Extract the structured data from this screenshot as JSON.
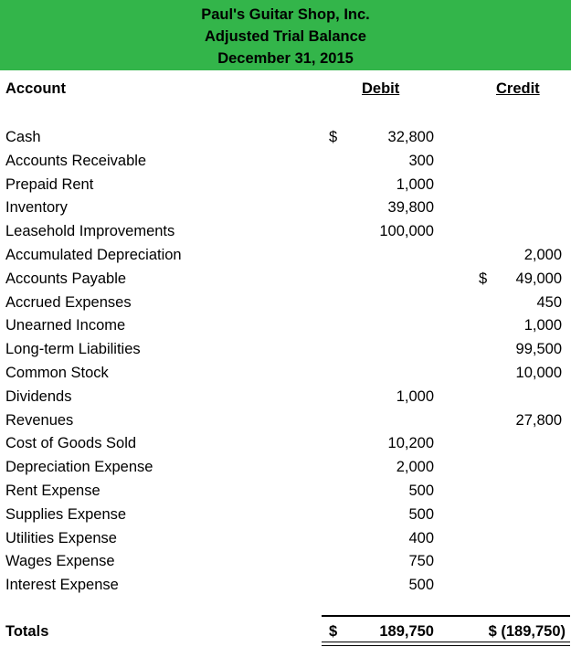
{
  "header": {
    "company": "Paul's Guitar Shop, Inc.",
    "title": "Adjusted Trial Balance",
    "date": "December 31, 2015",
    "banner_color": "#33b54a"
  },
  "columns": {
    "account": "Account",
    "debit": "Debit",
    "credit": "Credit"
  },
  "rows": [
    {
      "account": "Cash",
      "debit_symbol": "$",
      "debit": "32,800",
      "credit_symbol": "",
      "credit": ""
    },
    {
      "account": "Accounts Receivable",
      "debit_symbol": "",
      "debit": "300",
      "credit_symbol": "",
      "credit": ""
    },
    {
      "account": "Prepaid Rent",
      "debit_symbol": "",
      "debit": "1,000",
      "credit_symbol": "",
      "credit": ""
    },
    {
      "account": "Inventory",
      "debit_symbol": "",
      "debit": "39,800",
      "credit_symbol": "",
      "credit": ""
    },
    {
      "account": "Leasehold Improvements",
      "debit_symbol": "",
      "debit": "100,000",
      "credit_symbol": "",
      "credit": ""
    },
    {
      "account": "Accumulated Depreciation",
      "debit_symbol": "",
      "debit": "",
      "credit_symbol": "",
      "credit": "2,000"
    },
    {
      "account": "Accounts Payable",
      "debit_symbol": "",
      "debit": "",
      "credit_symbol": "$",
      "credit": "49,000"
    },
    {
      "account": "Accrued Expenses",
      "debit_symbol": "",
      "debit": "",
      "credit_symbol": "",
      "credit": "450"
    },
    {
      "account": "Unearned Income",
      "debit_symbol": "",
      "debit": "",
      "credit_symbol": "",
      "credit": "1,000"
    },
    {
      "account": "Long-term Liabilities",
      "debit_symbol": "",
      "debit": "",
      "credit_symbol": "",
      "credit": "99,500"
    },
    {
      "account": "Common Stock",
      "debit_symbol": "",
      "debit": "",
      "credit_symbol": "",
      "credit": "10,000"
    },
    {
      "account": "Dividends",
      "debit_symbol": "",
      "debit": "1,000",
      "credit_symbol": "",
      "credit": ""
    },
    {
      "account": "Revenues",
      "debit_symbol": "",
      "debit": "",
      "credit_symbol": "",
      "credit": "27,800"
    },
    {
      "account": "Cost of Goods Sold",
      "debit_symbol": "",
      "debit": "10,200",
      "credit_symbol": "",
      "credit": ""
    },
    {
      "account": "Depreciation Expense",
      "debit_symbol": "",
      "debit": "2,000",
      "credit_symbol": "",
      "credit": ""
    },
    {
      "account": "Rent Expense",
      "debit_symbol": "",
      "debit": "500",
      "credit_symbol": "",
      "credit": ""
    },
    {
      "account": "Supplies Expense",
      "debit_symbol": "",
      "debit": "500",
      "credit_symbol": "",
      "credit": ""
    },
    {
      "account": "Utilities Expense",
      "debit_symbol": "",
      "debit": "400",
      "credit_symbol": "",
      "credit": ""
    },
    {
      "account": "Wages Expense",
      "debit_symbol": "",
      "debit": "750",
      "credit_symbol": "",
      "credit": ""
    },
    {
      "account": "Interest Expense",
      "debit_symbol": "",
      "debit": "500",
      "credit_symbol": "",
      "credit": ""
    }
  ],
  "totals": {
    "label": "Totals",
    "debit_symbol": "$",
    "debit": "189,750",
    "credit": "$ (189,750)"
  }
}
